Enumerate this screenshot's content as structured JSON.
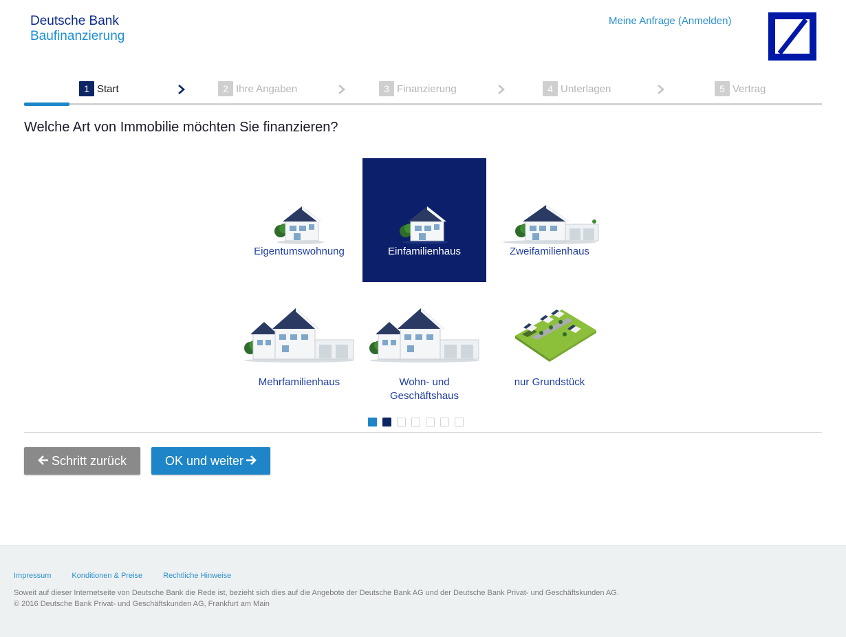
{
  "header": {
    "brand_line1": "Deutsche Bank",
    "brand_line2": "Baufinanzierung",
    "login_link": "Meine Anfrage (Anmelden)",
    "logo_icon": "deutsche-bank-logo"
  },
  "steps": [
    {
      "num": "1",
      "label": "Start",
      "state": "active"
    },
    {
      "num": "2",
      "label": "Ihre Angaben",
      "state": "inactive"
    },
    {
      "num": "3",
      "label": "Finanzierung",
      "state": "inactive"
    },
    {
      "num": "4",
      "label": "Unterlagen",
      "state": "inactive"
    },
    {
      "num": "5",
      "label": "Vertrag",
      "state": "inactive"
    }
  ],
  "question": "Welche Art von Immobilie möchten Sie finanzieren?",
  "options": [
    {
      "label": "Eigentumswohnung",
      "icon": "apartment-house-icon",
      "selected": false
    },
    {
      "label": "Einfamilienhaus",
      "icon": "single-family-house-icon",
      "selected": true
    },
    {
      "label": "Zweifamilienhaus",
      "icon": "two-family-house-icon",
      "selected": false
    },
    {
      "label": "Mehrfamilienhaus",
      "icon": "multi-family-house-icon",
      "selected": false
    },
    {
      "label_line1": "Wohn- und",
      "label_line2": "Geschäftshaus",
      "icon": "residential-commercial-house-icon",
      "selected": false
    },
    {
      "label": "nur Grundstück",
      "icon": "land-plot-icon",
      "selected": false
    }
  ],
  "progress_dots": {
    "total": 7,
    "completed": 1,
    "current": 2
  },
  "buttons": {
    "back": "Schritt zurück",
    "next": "OK und weiter"
  },
  "colors": {
    "brand_blue": "#0018a8",
    "navy": "#0c2663",
    "accent": "#1e86c8",
    "selected_tile": "#0c1f6a",
    "back_button": "#8a8a8a"
  },
  "footer": {
    "links": [
      "Impressum",
      "Konditionen & Preise",
      "Rechtliche Hinweise"
    ],
    "note1": "Soweit auf dieser Internetseite von Deutsche Bank die Rede ist, bezieht sich dies auf die Angebote der Deutsche Bank AG und der Deutsche Bank Privat- und Geschäftskunden AG.",
    "note2": "© 2016 Deutsche Bank Privat- und Geschäftskunden AG, Frankfurt am Main"
  }
}
